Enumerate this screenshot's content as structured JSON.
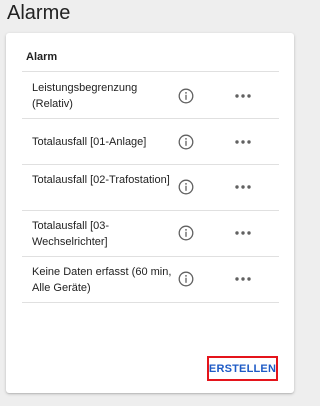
{
  "page": {
    "title": "Alarme"
  },
  "table": {
    "header": "Alarm",
    "rows": [
      {
        "label": "Leistungsbegrenzung (Relativ)"
      },
      {
        "label": "Totalausfall [01-Anlage]"
      },
      {
        "label": "Totalausfall [02-Trafostation]"
      },
      {
        "label": "Totalausfall [03-Wechselrichter]"
      },
      {
        "label": "Keine Daten erfasst (60 min, Alle Geräte)"
      }
    ]
  },
  "actions": {
    "create_label": "ERSTELLEN"
  },
  "colors": {
    "accent": "#1e5bc6",
    "highlight_border": "#e4141b",
    "icon": "#616161"
  },
  "icons": {
    "info": "info-icon",
    "more": "more-horizontal-icon"
  }
}
